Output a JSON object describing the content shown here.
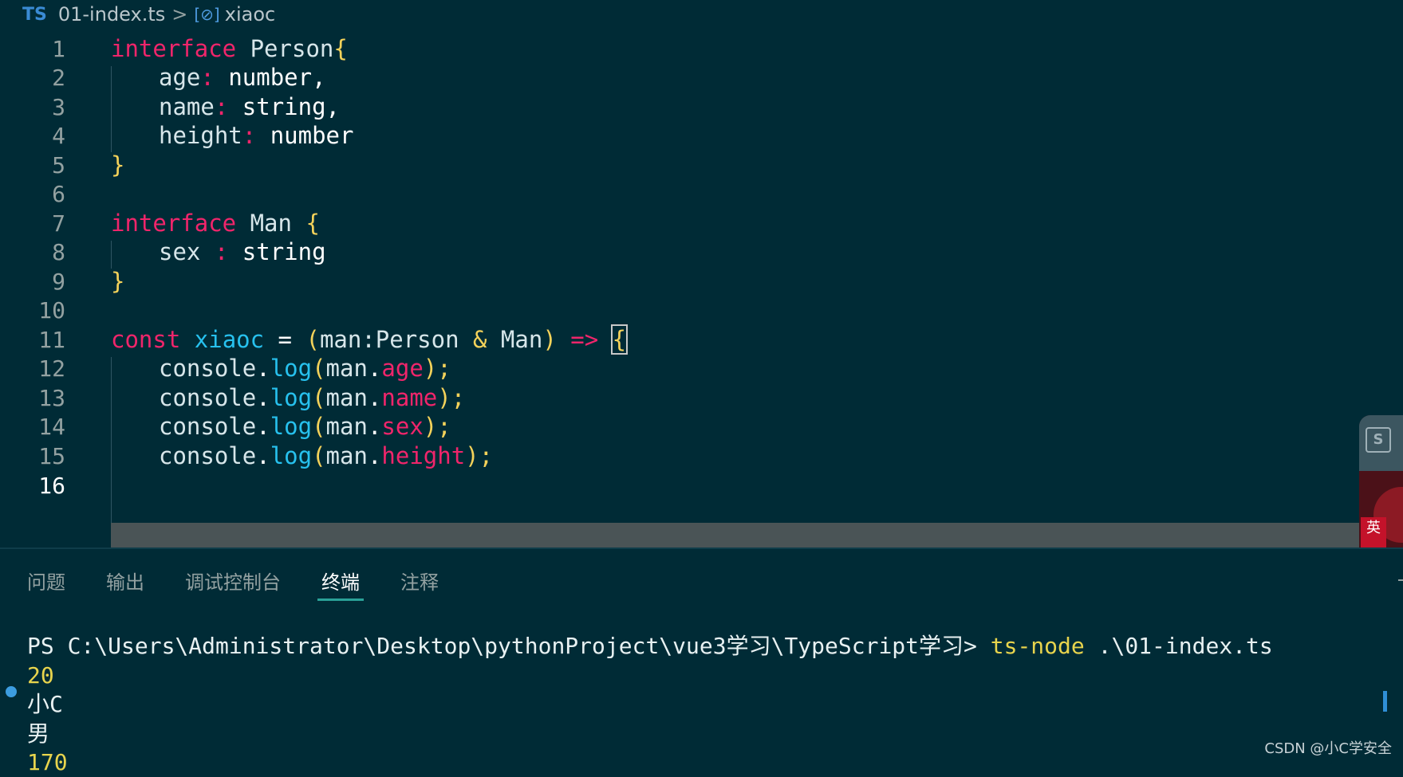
{
  "breadcrumb": {
    "lang_badge": "TS",
    "file": "01-index.ts",
    "separator": ">",
    "symbol_icon": "[⊘]",
    "symbol": "xiaoc"
  },
  "editor": {
    "line_numbers": [
      "1",
      "2",
      "3",
      "4",
      "5",
      "6",
      "7",
      "8",
      "9",
      "10",
      "11",
      "12",
      "13",
      "14",
      "15",
      "16"
    ],
    "lines": [
      {
        "kw": "interface",
        "name": " Person",
        "brace": "{"
      },
      {
        "prop": "age",
        "colon": ":",
        "type": " number",
        "punc": ","
      },
      {
        "prop": "name",
        "colon": ":",
        "type": " string",
        "punc": ","
      },
      {
        "prop": "height",
        "colon": ":",
        "type": " number",
        "punc": ""
      },
      {
        "brace": "}"
      },
      {},
      {
        "kw": "interface",
        "name": " Man ",
        "brace": "{"
      },
      {
        "prop": "sex",
        "colon": " :",
        "type": " string",
        "punc": ""
      },
      {
        "brace": "}"
      },
      {},
      {
        "kw": "const",
        "fn": " xiaoc",
        "eq": " = ",
        "paren_open": "(",
        "arg": "man:Person ",
        "amp": "&",
        "arg2": " Man",
        "paren_close": ")",
        "arrow": " => ",
        "brace": "{"
      },
      {
        "obj": "console",
        "dot": ".",
        "fn": "log",
        "po": "(",
        "var": "man",
        "dot2": ".",
        "prop": "age",
        "pc": ");"
      },
      {
        "obj": "console",
        "dot": ".",
        "fn": "log",
        "po": "(",
        "var": "man",
        "dot2": ".",
        "prop": "name",
        "pc": ");"
      },
      {
        "obj": "console",
        "dot": ".",
        "fn": "log",
        "po": "(",
        "var": "man",
        "dot2": ".",
        "prop": "sex",
        "pc": ");"
      },
      {
        "obj": "console",
        "dot": ".",
        "fn": "log",
        "po": "(",
        "var": "man",
        "dot2": ".",
        "prop": "height",
        "pc": ");"
      },
      {}
    ]
  },
  "panel": {
    "tabs": [
      "问题",
      "输出",
      "调试控制台",
      "终端",
      "注释"
    ],
    "active_tab": "终端",
    "terminal": {
      "prompt": "PS C:\\Users\\Administrator\\Desktop\\pythonProject\\vue3学习\\TypeScript学习> ",
      "command": "ts-node",
      "arg": " .\\01-index.ts",
      "output": [
        "20",
        "小C",
        "男",
        "170"
      ]
    }
  },
  "widget": {
    "badge": "S",
    "tag": "英"
  },
  "watermark": "CSDN @小C学安全",
  "colors": {
    "background": "#002b36",
    "keyword": "#f0256b",
    "function": "#27c1ee",
    "number_output": "#e8d44d",
    "active_tab_underline": "#2aa198"
  }
}
